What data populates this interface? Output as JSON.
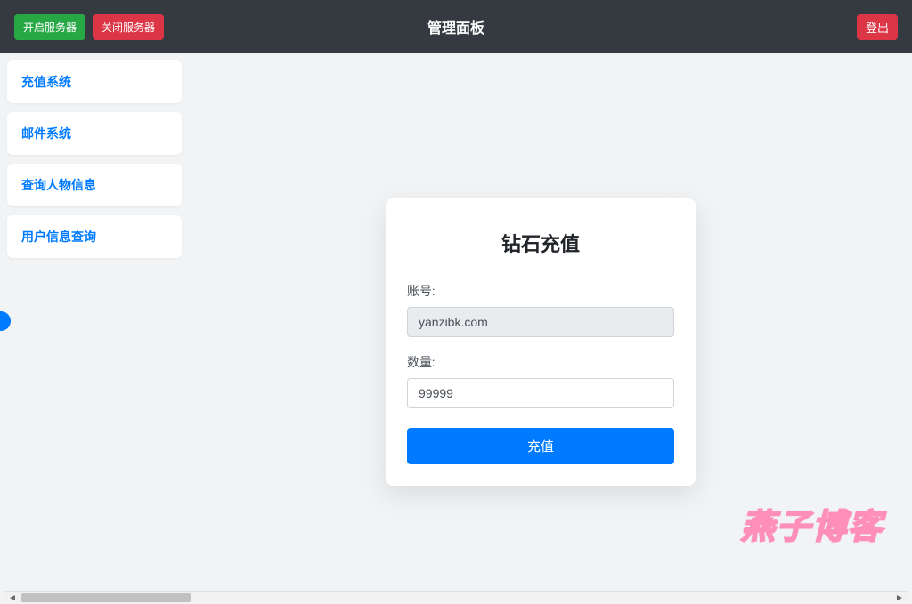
{
  "header": {
    "start_server_label": "开启服务器",
    "stop_server_label": "关闭服务器",
    "title": "管理面板",
    "logout_label": "登出"
  },
  "sidebar": {
    "items": [
      {
        "label": "充值系统"
      },
      {
        "label": "邮件系统"
      },
      {
        "label": "查询人物信息"
      },
      {
        "label": "用户信息查询"
      }
    ]
  },
  "card": {
    "title": "钻石充值",
    "account_label": "账号:",
    "account_value": "yanzibk.com",
    "amount_label": "数量:",
    "amount_value": "99999",
    "submit_label": "充值"
  },
  "watermark": "燕子博客",
  "colors": {
    "primary": "#007bff",
    "success": "#28a745",
    "danger": "#dc3545",
    "header_bg": "#343a40"
  }
}
